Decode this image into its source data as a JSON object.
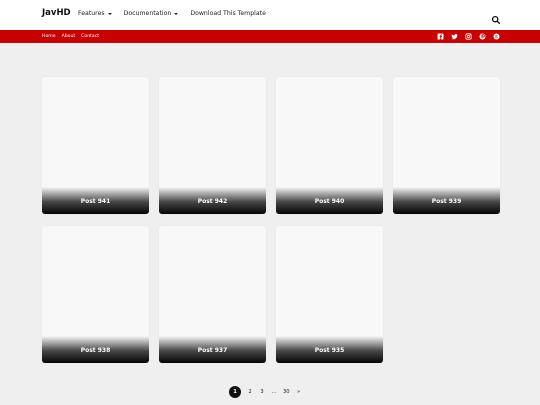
{
  "header": {
    "brand": "JavHD",
    "nav": [
      {
        "label": "Features",
        "dropdown": true
      },
      {
        "label": "Documentation",
        "dropdown": true
      },
      {
        "label": "Download This Template",
        "dropdown": false
      }
    ],
    "search_icon": "search-icon"
  },
  "subnav": {
    "links": [
      "Home",
      "About",
      "Contact"
    ],
    "social_icons": [
      "facebook-icon",
      "twitter-icon",
      "instagram-icon",
      "pinterest-icon",
      "skype-icon"
    ]
  },
  "colors": {
    "accent": "#c90000",
    "background": "#efefef"
  },
  "posts": [
    {
      "title": "Post 941"
    },
    {
      "title": "Post 942"
    },
    {
      "title": "Post 940"
    },
    {
      "title": "Post 939"
    },
    {
      "title": "Post 938"
    },
    {
      "title": "Post 937"
    },
    {
      "title": "Post 935"
    }
  ],
  "pagination": {
    "current": "1",
    "pages": [
      "2",
      "3"
    ],
    "ellipsis": "...",
    "last": "30",
    "next": "»"
  }
}
